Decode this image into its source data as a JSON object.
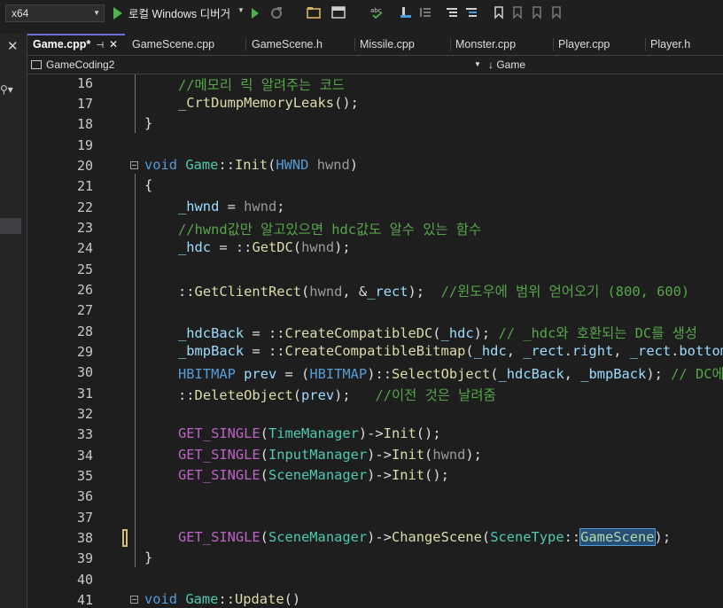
{
  "toolbar": {
    "platform": "x64",
    "run_label": "로컬 Windows 디버거"
  },
  "tabs": [
    {
      "label": "Game.cpp*",
      "active": true
    },
    {
      "label": "GameScene.cpp"
    },
    {
      "label": "GameScene.h"
    },
    {
      "label": "Missile.cpp"
    },
    {
      "label": "Monster.cpp"
    },
    {
      "label": "Player.cpp"
    },
    {
      "label": "Player.h"
    }
  ],
  "navbar": {
    "project": "GameCoding2",
    "scope": "Game"
  },
  "line_numbers": [
    "16",
    "17",
    "18",
    "19",
    "20",
    "21",
    "22",
    "23",
    "24",
    "25",
    "26",
    "27",
    "28",
    "29",
    "30",
    "31",
    "32",
    "33",
    "34",
    "35",
    "36",
    "37",
    "38",
    "39",
    "40",
    "41"
  ],
  "code": {
    "l16": "//메모리 릭 알려주는 코드",
    "l17_fn": "_CrtDumpMemoryLeaks",
    "l17_rest": "();",
    "l18": "}",
    "l20_kw": "void",
    "l20_cls": "Game",
    "l20_sep": "::",
    "l20_fn": "Init",
    "l20_p1": "(",
    "l20_type": "HWND",
    "l20_param": "hwnd",
    "l20_p2": ")",
    "l21": "{",
    "l22_var": "_hwnd",
    "l22_eq": " = ",
    "l22_param": "hwnd",
    "l22_end": ";",
    "l23": "//hwnd값만 알고있으면 hdc값도 알수 있는 함수",
    "l24_var": "_hdc",
    "l24_eq": " = ",
    "l24_sep": "::",
    "l24_fn": "GetDC",
    "l24_p1": "(",
    "l24_param": "hwnd",
    "l24_end": ");",
    "l26_sep": "::",
    "l26_fn": "GetClientRect",
    "l26_p1": "(",
    "l26_param": "hwnd",
    "l26_mid": ", &",
    "l26_var": "_rect",
    "l26_end": ");  ",
    "l26_cmt": "//윈도우에 범위 얻어오기 (800, 600)",
    "l28_var": "_hdcBack",
    "l28_eq": " = ",
    "l28_sep": "::",
    "l28_fn": "CreateCompatibleDC",
    "l28_p1": "(",
    "l28_arg": "_hdc",
    "l28_end": "); ",
    "l28_cmt": "// _hdc와 호환되는 DC를 생성",
    "l29_var": "_bmpBack",
    "l29_eq": " = ",
    "l29_sep": "::",
    "l29_fn": "CreateCompatibleBitmap",
    "l29_p1": "(",
    "l29_a1": "_hdc",
    "l29_c1": ", ",
    "l29_a2": "_rect",
    "l29_dot1": ".",
    "l29_a3": "right",
    "l29_c2": ", ",
    "l29_a4": "_rect",
    "l29_dot2": ".",
    "l29_a5": "bottom",
    "l29_end": ");",
    "l30_type": "HBITMAP",
    "l30_sp": " ",
    "l30_var": "prev",
    "l30_eq": " = (",
    "l30_type2": "HBITMAP",
    "l30_cl": ")",
    "l30_sep": "::",
    "l30_fn": "SelectObject",
    "l30_p1": "(",
    "l30_a1": "_hdcBack",
    "l30_c": ", ",
    "l30_a2": "_bmpBack",
    "l30_end": "); ",
    "l30_cmt": "// DC에 BMP를 연결",
    "l31_sep": "::",
    "l31_fn": "DeleteObject",
    "l31_p1": "(",
    "l31_var": "prev",
    "l31_end": ");   ",
    "l31_cmt": "//이전 것은 날려줌",
    "l33_macro": "GET_SINGLE",
    "l33_p1": "(",
    "l33_type": "TimeManager",
    "l33_arrow": ")->",
    "l33_fn": "Init",
    "l33_end": "();",
    "l34_macro": "GET_SINGLE",
    "l34_p1": "(",
    "l34_type": "InputManager",
    "l34_arrow": ")->",
    "l34_fn": "Init",
    "l34_p2": "(",
    "l34_param": "hwnd",
    "l34_end": ");",
    "l35_macro": "GET_SINGLE",
    "l35_p1": "(",
    "l35_type": "SceneManager",
    "l35_arrow": ")->",
    "l35_fn": "Init",
    "l35_end": "();",
    "l38_macro": "GET_SINGLE",
    "l38_p1": "(",
    "l38_type": "SceneManager",
    "l38_arrow": ")->",
    "l38_fn": "ChangeScene",
    "l38_p2": "(",
    "l38_type2": "SceneType",
    "l38_sep": "::",
    "l38_enum": "GameScene",
    "l38_end": ");",
    "l39": "}",
    "l41_kw": "void",
    "l41_cls": "Game",
    "l41_sep": "::",
    "l41_fn": "Update",
    "l41_end": "()"
  }
}
